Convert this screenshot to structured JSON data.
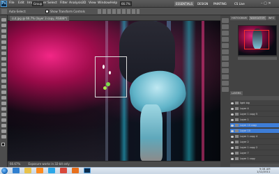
{
  "menubar": {
    "items": [
      "File",
      "Edit",
      "Image",
      "Layer",
      "Select",
      "Filter",
      "Analysis",
      "3D",
      "View",
      "Window",
      "Help"
    ],
    "zoom": "66.7%",
    "workspace": "ESSENTIALS",
    "design": "DESIGN",
    "painting": "PAINTING",
    "cs_live": "CS Live"
  },
  "options": {
    "auto_select": "Auto-Select:",
    "auto_select_value": "Group",
    "show_transform": "Show Transform Controls"
  },
  "document": {
    "tab_title": "cut.jpg @ 66.7% (layer 3 copy, RGB/8*)"
  },
  "status": {
    "zoom": "66.67%",
    "info": "Exposure works in 32-bit only"
  },
  "panels": {
    "navigator_tabs": [
      "HISTOGRAM",
      "NAVIGATOR",
      "INFO"
    ],
    "layers_tab": "LAYERS",
    "layers": [
      {
        "name": "light big",
        "selected": false
      },
      {
        "name": "Layer 4",
        "selected": false
      },
      {
        "name": "Layer 1 copy 5",
        "selected": false
      },
      {
        "name": "Layer 1",
        "selected": false
      },
      {
        "name": "Layer 10 copy",
        "selected": true
      },
      {
        "name": "Layer 10",
        "selected": true
      },
      {
        "name": "Layer 1 copy 4",
        "selected": false
      },
      {
        "name": "Layer 2",
        "selected": false
      },
      {
        "name": "Layer 1 copy 2",
        "selected": false
      },
      {
        "name": "Layer 7",
        "selected": false
      },
      {
        "name": "Layer 1 copy",
        "selected": false
      }
    ]
  },
  "taskbar": {
    "time": "9:08 AM",
    "date": "1/12/2011",
    "apps": [
      "ie",
      "explorer",
      "media-player",
      "skype",
      "chrome",
      "firefox",
      "photoshop"
    ]
  },
  "colors": {
    "accent_selected_layer": "#3d7dd8",
    "canvas_magenta": "#e0287a",
    "canvas_cyan": "#28c8e0"
  }
}
